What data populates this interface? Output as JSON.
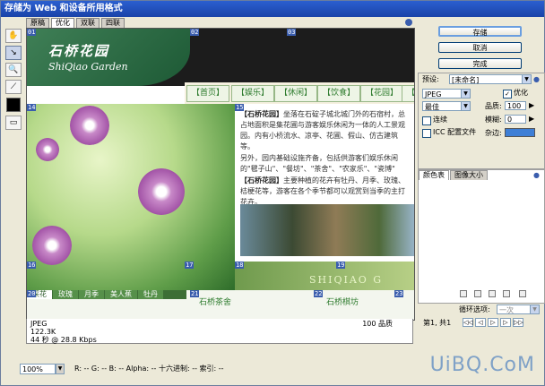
{
  "window": {
    "title": "存储为 Web 和设备所用格式"
  },
  "view_tabs": [
    "原稿",
    "优化",
    "双联",
    "四联"
  ],
  "active_view_tab": 1,
  "tools": [
    "hand-icon",
    "slice-select-icon",
    "zoom-icon",
    "eyedropper-icon"
  ],
  "preview": {
    "logo_cn": "石桥花园",
    "logo_en": "ShiQiao Garden",
    "nav_items": [
      "【首页】",
      "【娱乐】",
      "【休闲】",
      "【饮食】",
      "【花园】",
      "【】"
    ],
    "paragraph1_title": "【石桥花园】",
    "paragraph1": "坐落在石碇子城北城门外的石宿村，总占地面积是集花圃与游客娱乐休闲为一体的人工景观园。内有小桥流水、凉亭、花圃、假山、仿古建筑等。",
    "paragraph2": "另外，园内基础设施齐备，包括供游客们娱乐休闲的\"毽子山\"、\"餐坊\"、\"茶舍\"、\"农家乐\"、\"瓷博\"",
    "paragraph3_title": "【石桥花园】",
    "paragraph3": "主要种植的花卉有牡丹、月季、玫瑰、桔梗花等，游客在各个季节都可以观赏到当季的主打花卉。",
    "strip_logo": "SHIQIAO G",
    "sub_tabs": [
      "采花",
      "玫瑰",
      "月季",
      "美人蕉",
      "牡丹"
    ],
    "box_left_title": "石桥茶舍",
    "box_right_title": "石桥棋坊",
    "slice_numbers": [
      "01",
      "02",
      "03",
      "14",
      "15",
      "16",
      "17",
      "18",
      "19",
      "20",
      "21",
      "22",
      "23"
    ]
  },
  "info": {
    "format": "JPEG",
    "size": "122.3K",
    "time": "44 秒 @ 28.8 Kbps",
    "quality": "100 品质"
  },
  "status": {
    "zoom": "100%",
    "readout": "R: --  G: --  B: --  Alpha: --  十六进制: --  索引: --"
  },
  "buttons": {
    "save": "存储",
    "cancel": "取消",
    "done": "完成"
  },
  "settings": {
    "preset_label": "预设:",
    "preset_value": "[未命名]",
    "format_value": "JPEG",
    "optimize_label": "优化",
    "quality_preset": "最佳",
    "quality_label": "品质:",
    "quality_value": "100",
    "progressive_label": "连续",
    "blur_label": "模糊:",
    "blur_value": "0",
    "icc_label": "ICC 配置文件",
    "matte_label": "杂边:",
    "matte_color": "#3e7fd6"
  },
  "panel": {
    "tabs": [
      "颜色表",
      "图像大小"
    ],
    "loop_label": "循环选项:",
    "loop_value": "一次",
    "frame_label": "第1, 共1"
  },
  "watermark": "UiBQ.CoM"
}
